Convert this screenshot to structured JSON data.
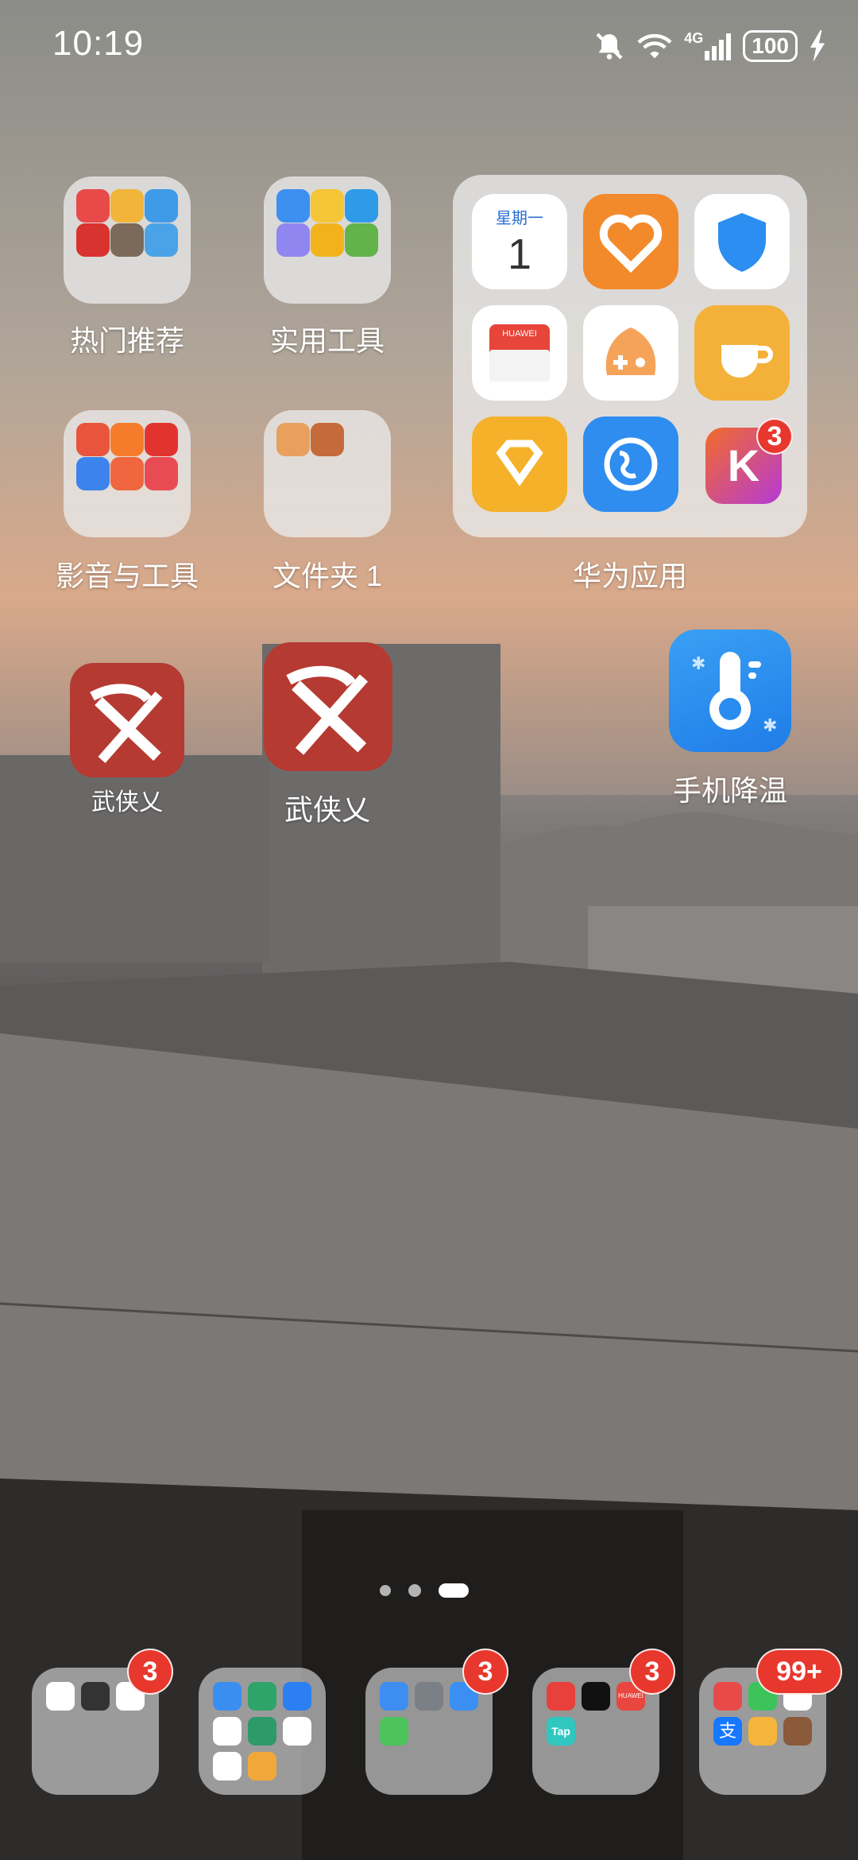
{
  "status_bar": {
    "time": "10:19",
    "network": "4G",
    "battery": "100",
    "icons": [
      "bell-muted-icon",
      "wifi-icon",
      "signal-icon",
      "battery-icon",
      "charging-icon"
    ]
  },
  "folders": {
    "hot": {
      "label": "热门推荐"
    },
    "tools": {
      "label": "实用工具"
    },
    "media": {
      "label": "影音与工具"
    },
    "folder1": {
      "label": "文件夹 1"
    },
    "huawei": {
      "label": "华为应用",
      "calendar_weekday": "星期一",
      "calendar_day": "1",
      "badge": "3",
      "huawei_label": "HUAWEI"
    }
  },
  "apps": {
    "wuxia_small": {
      "label": "武侠乂"
    },
    "wuxia_large": {
      "label": "武侠乂"
    },
    "cooling": {
      "label": "手机降温"
    }
  },
  "page_indicator": {
    "pages": 3,
    "current": 3
  },
  "dock": {
    "folder1_badge": "3",
    "folder3_badge": "3",
    "folder4_badge": "3",
    "folder5_badge": "99+",
    "tap_label": "Tap",
    "alipay_label": "支",
    "huawei_label": "HUAWEI"
  },
  "colors": {
    "badge": "#e8382e",
    "wuxia": "#b53a32",
    "cooling": "#2f8ef0"
  }
}
